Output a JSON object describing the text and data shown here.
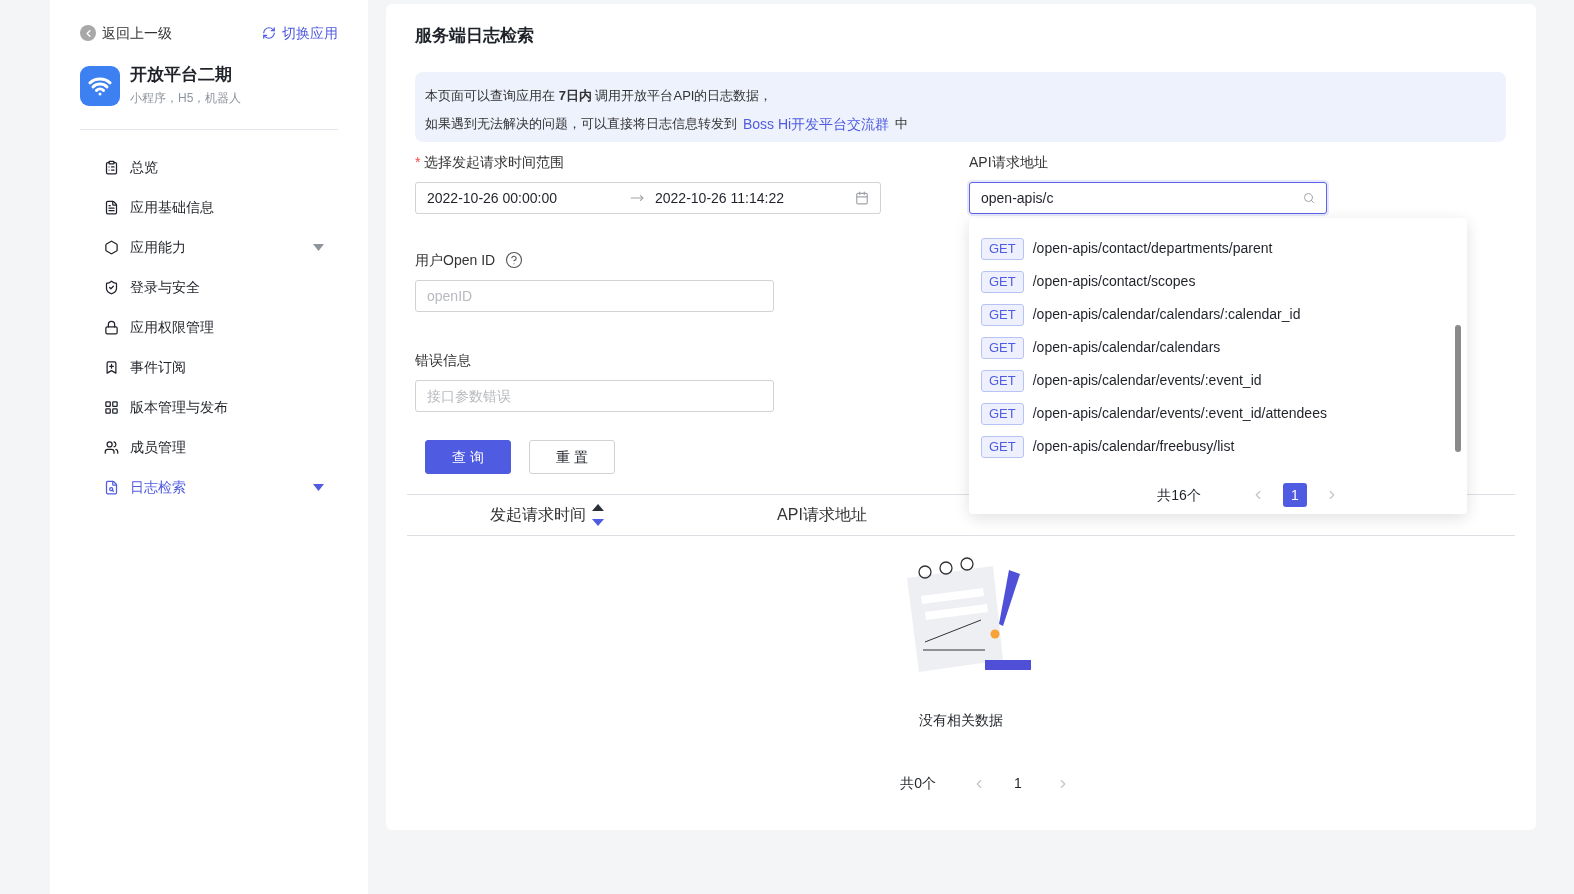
{
  "sidebar": {
    "back": "返回上一级",
    "switch": "切换应用",
    "app": {
      "name": "开放平台二期",
      "subtitle": "小程序，H5，机器人"
    },
    "items": [
      {
        "label": "总览",
        "selected": false,
        "expandable": false
      },
      {
        "label": "应用基础信息",
        "selected": false,
        "expandable": false
      },
      {
        "label": "应用能力",
        "selected": false,
        "expandable": true
      },
      {
        "label": "登录与安全",
        "selected": false,
        "expandable": false
      },
      {
        "label": "应用权限管理",
        "selected": false,
        "expandable": false
      },
      {
        "label": "事件订阅",
        "selected": false,
        "expandable": false
      },
      {
        "label": "版本管理与发布",
        "selected": false,
        "expandable": false
      },
      {
        "label": "成员管理",
        "selected": false,
        "expandable": false
      },
      {
        "label": "日志检索",
        "selected": true,
        "expandable": true
      }
    ]
  },
  "page": {
    "title": "服务端日志检索",
    "notice": {
      "line1": "本页面可以查询应用在 **7日内** 调用开放平台API的日志数据，",
      "line2_before": "如果遇到无法解决的问题，可以直接将日志信息转发到",
      "link": "Boss Hi开发平台交流群",
      "line2_after": "中"
    },
    "form": {
      "time_range": {
        "label": "选择发起请求时间范围",
        "required_mark": "*",
        "start": "2022-10-26 00:00:00",
        "end": "2022-10-26 11:14:22"
      },
      "api": {
        "label": "API请求地址",
        "value": "open-apis/c"
      },
      "open_id": {
        "label": "用户Open ID",
        "placeholder": "openID"
      },
      "error": {
        "label": "错误信息",
        "placeholder": "接口参数错误"
      },
      "buttons": [
        {
          "label": "查 询",
          "kind": "primary"
        },
        {
          "label": "重 置",
          "kind": "default"
        }
      ]
    },
    "table": {
      "columns": [
        {
          "label": "发起请求时间",
          "sortable": true,
          "sorted_desc": true
        },
        {
          "label": "API请求地址",
          "sortable": false
        }
      ],
      "empty_text": "没有相关数据",
      "pagination": {
        "total": "共0个",
        "page": "1"
      }
    }
  },
  "dropdown": {
    "items": [
      {
        "method": "GET",
        "path": "/open-apis/contact/departments/parent"
      },
      {
        "method": "GET",
        "path": "/open-apis/contact/scopes"
      },
      {
        "method": "GET",
        "path": "/open-apis/calendar/calendars/:calendar_id"
      },
      {
        "method": "GET",
        "path": "/open-apis/calendar/calendars"
      },
      {
        "method": "GET",
        "path": "/open-apis/calendar/events/:event_id"
      },
      {
        "method": "GET",
        "path": "/open-apis/calendar/events/:event_id/attendees"
      },
      {
        "method": "GET",
        "path": "/open-apis/calendar/freebusy/list"
      }
    ],
    "total": "共16个",
    "page": "1"
  }
}
